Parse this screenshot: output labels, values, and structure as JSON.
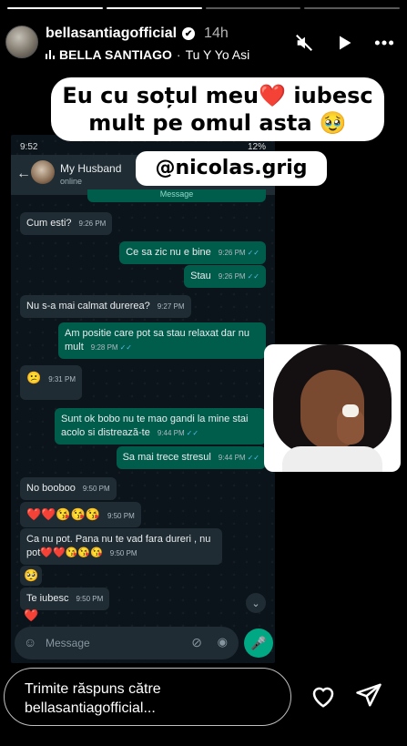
{
  "story": {
    "progress_segments": [
      1,
      1,
      0,
      0
    ],
    "username": "bellasantiagofficial",
    "verified": "✔",
    "time": "14h",
    "music_artist": "BELLA SANTIAGO",
    "music_sep": "·",
    "music_title": "Tu Y Yo Asi",
    "icons": [
      "mute-icon",
      "play-icon",
      "more-icon"
    ]
  },
  "stickers": {
    "caption_line1": "Eu cu soțul meu❤️ iubesc",
    "caption_line2": "mult pe omul asta 🥹",
    "mention": "@nicolas.grig"
  },
  "chat": {
    "status_time": "9:52",
    "status_right": "12%",
    "contact_name": "My Husband",
    "contact_status": "online",
    "cut_off": "Message",
    "messages": [
      {
        "dir": "in",
        "text": "Cum esti?",
        "time": "9:26 PM"
      },
      {
        "dir": "out",
        "text": "Ce sa zic nu e bine",
        "time": "9:26 PM"
      },
      {
        "dir": "out",
        "text": "Stau",
        "time": "9:26 PM"
      },
      {
        "dir": "in",
        "text": "Nu s-a mai calmat durerea?",
        "time": "9:27 PM"
      },
      {
        "dir": "out",
        "text": "Am positie care pot sa stau relaxat dar nu mult",
        "time": "9:28 PM"
      },
      {
        "dir": "in",
        "text": "😕",
        "time": "9:31 PM"
      },
      {
        "dir": "out",
        "text": "Sunt ok bobo nu te mao gandi la mine stai acolo si distrează-te",
        "time": "9:44 PM"
      },
      {
        "dir": "out",
        "text": "Sa mai trece stresul",
        "time": "9:44 PM"
      },
      {
        "dir": "in",
        "text": "No booboo",
        "time": "9:50 PM"
      },
      {
        "dir": "in",
        "text": "❤️❤️😘😘😘",
        "time": "9:50 PM"
      },
      {
        "dir": "in",
        "text": "Ca nu pot. Pana nu te vad fara dureri , nu pot❤️❤️😘😘😘",
        "time": "9:50 PM"
      },
      {
        "dir": "in",
        "text": "🥺",
        "time": ""
      },
      {
        "dir": "in",
        "text": "Te iubesc",
        "time": "9:50 PM"
      },
      {
        "dir": "in",
        "text": "❤️",
        "time": ""
      }
    ],
    "input_placeholder": "Message",
    "tick": "✓✓"
  },
  "reply": {
    "placeholder_line1": "Trimite răspuns către",
    "placeholder_line2": "bellasantiagofficial..."
  },
  "colors": {
    "chat_bg": "#0b141a",
    "incoming": "#202c33",
    "outgoing": "#005c4b",
    "mic": "#00a884"
  }
}
